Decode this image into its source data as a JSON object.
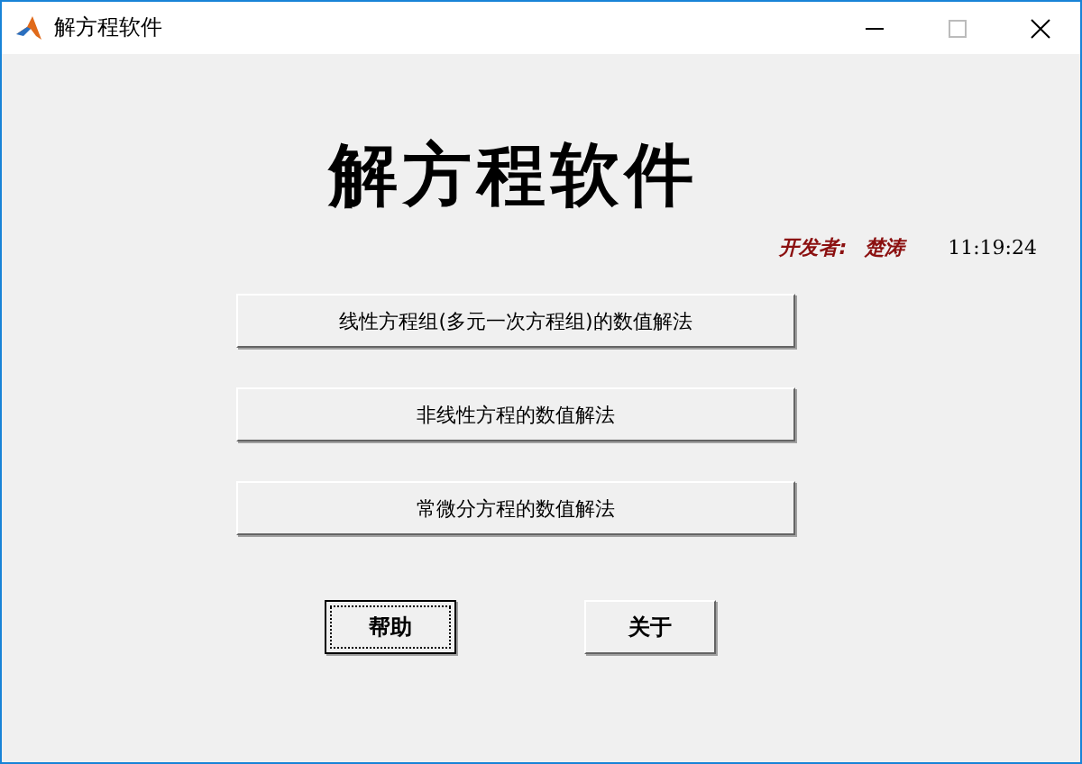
{
  "window": {
    "title": "解方程软件"
  },
  "heading": "解方程软件",
  "developer": {
    "label": "开发者:",
    "name": "楚涛"
  },
  "clock": "11:19:24",
  "method_buttons": [
    "线性方程组(多元一次方程组)的数值解法",
    "非线性方程的数值解法",
    "常微分方程的数值解法"
  ],
  "footer_buttons": [
    {
      "label": "帮助",
      "focused": true
    },
    {
      "label": "关于",
      "focused": false
    }
  ]
}
